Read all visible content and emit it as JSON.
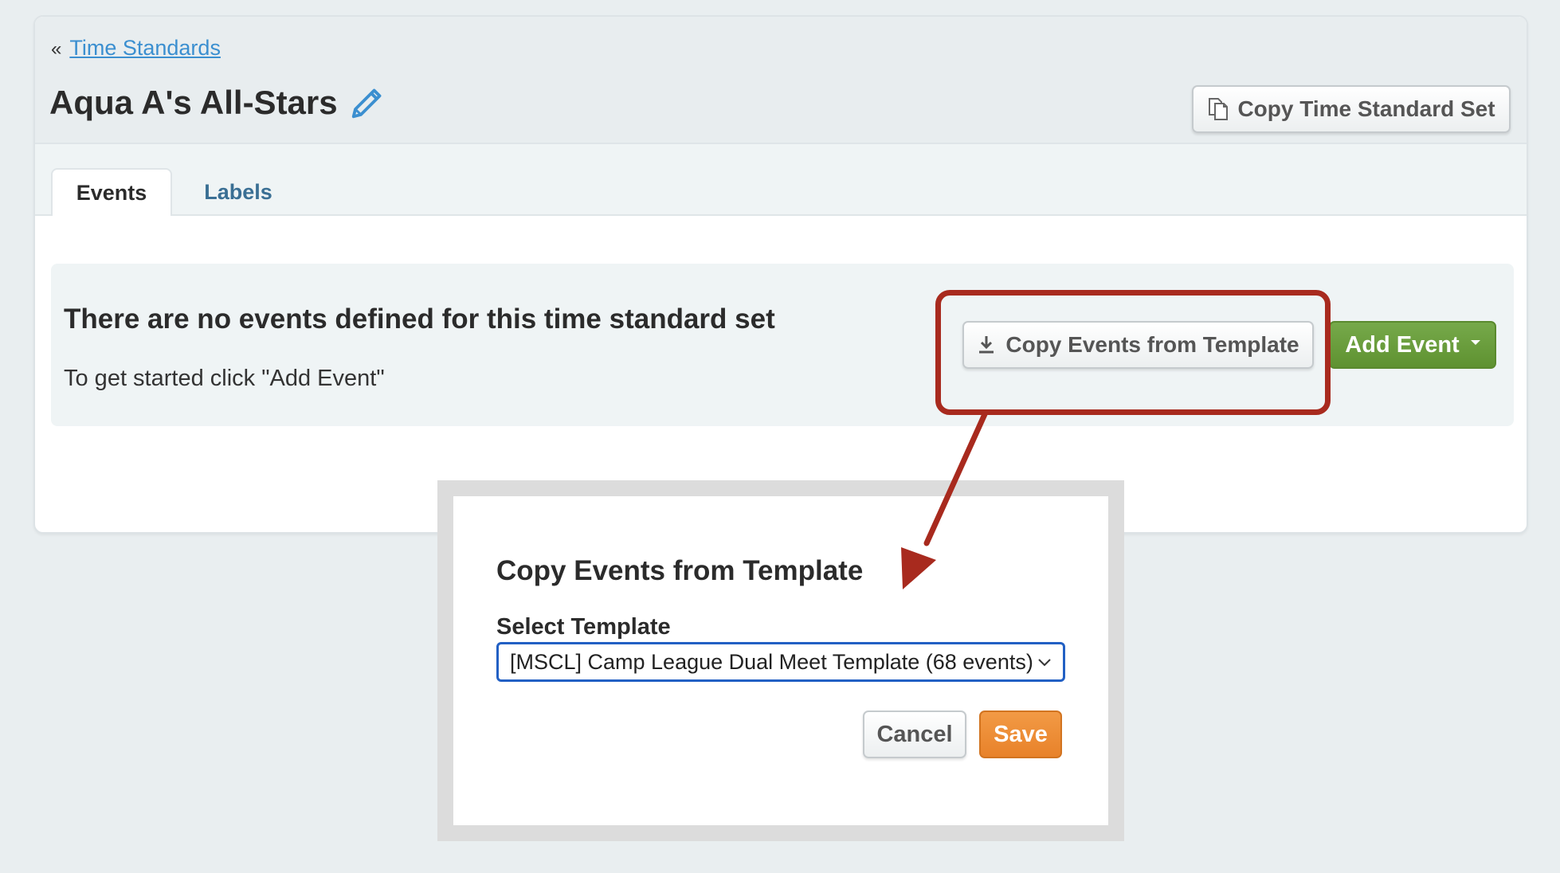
{
  "breadcrumb": {
    "prefix": "«",
    "link": "Time Standards"
  },
  "page": {
    "title": "Aqua A's All-Stars"
  },
  "header": {
    "copy_set_label": "Copy Time Standard Set"
  },
  "tabs": [
    {
      "label": "Events",
      "active": true
    },
    {
      "label": "Labels",
      "active": false
    }
  ],
  "empty_state": {
    "title": "There are no events defined for this time standard set",
    "subtitle": "To get started click \"Add Event\""
  },
  "actions": {
    "copy_events_label": "Copy Events from Template",
    "add_event_label": "Add Event"
  },
  "modal": {
    "title": "Copy Events from Template",
    "select_label": "Select Template",
    "selected_template": "[MSCL] Camp League Dual Meet Template (68 events)",
    "cancel_label": "Cancel",
    "save_label": "Save"
  },
  "colors": {
    "link": "#3b8fd0",
    "add_event": "#6aa03d",
    "save": "#ef8f37",
    "annotation": "#a82a1e",
    "select_focus": "#2260c4"
  }
}
